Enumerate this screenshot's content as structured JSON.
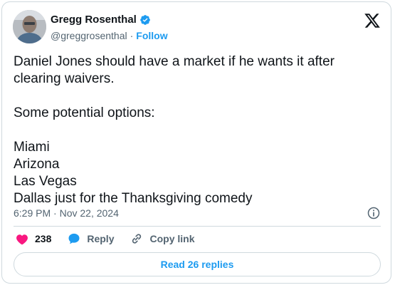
{
  "author": {
    "name": "Gregg Rosenthal",
    "handle": "@greggrosenthal",
    "separator": "·",
    "follow_label": "Follow"
  },
  "tweet": {
    "text": "Daniel Jones should have a market if he wants it after clearing waivers.\n\nSome potential options:\n\nMiami\nArizona\nLas Vegas\nDallas just for the Thanksgiving comedy",
    "timestamp": "6:29 PM · Nov 22, 2024"
  },
  "actions": {
    "like_count": "238",
    "reply_label": "Reply",
    "copy_link_label": "Copy link"
  },
  "read_replies_label": "Read 26 replies",
  "colors": {
    "accent": "#1d9bf0",
    "like": "#f91880",
    "text": "#0f1419",
    "muted": "#536471",
    "border": "#cfd9de"
  },
  "icons": [
    "verified-badge-icon",
    "x-logo-icon",
    "info-icon",
    "heart-icon",
    "reply-icon",
    "link-icon"
  ]
}
